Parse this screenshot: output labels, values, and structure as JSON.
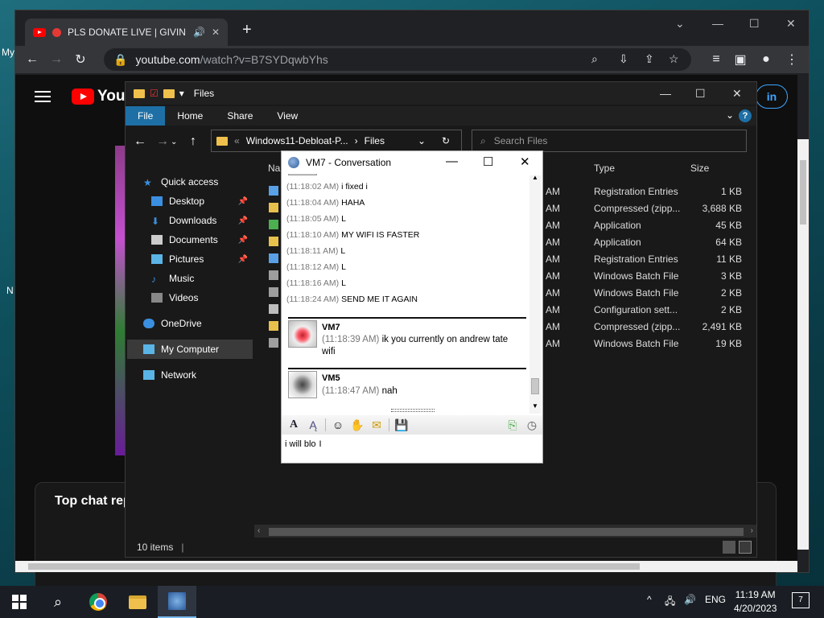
{
  "desktop": {
    "label_top": "My",
    "label_mid": "N"
  },
  "browser": {
    "tab_title": "PLS DONATE LIVE | GIVIN",
    "url_host": "youtube.com",
    "url_path": "/watch?v=B7SYDqwbYhs",
    "new_tab_label": "+",
    "minimize": "—",
    "maximize": "☐",
    "close": "✕"
  },
  "youtube": {
    "logo_text": "YouTu",
    "signin_label": "in",
    "chat_title": "Top chat rep"
  },
  "explorer": {
    "title": "Files",
    "ribbon_tabs": [
      "File",
      "Home",
      "Share",
      "View"
    ],
    "address_path_1": "Windows11-Debloat-P...",
    "address_sep": "›",
    "address_path_2": "Files",
    "search_placeholder": "Search Files",
    "nav": {
      "quick_access": "Quick access",
      "desktop": "Desktop",
      "downloads": "Downloads",
      "documents": "Documents",
      "pictures": "Pictures",
      "music": "Music",
      "videos": "Videos",
      "onedrive": "OneDrive",
      "mycomputer": "My Computer",
      "network": "Network"
    },
    "columns": {
      "name": "Na",
      "type": "Type",
      "size": "Size"
    },
    "files": [
      {
        "time": "AM",
        "type": "Registration Entries",
        "size": "1 KB",
        "color": "#5aa0e6"
      },
      {
        "time": "AM",
        "type": "Compressed (zipp...",
        "size": "3,688 KB",
        "color": "#e8c14c"
      },
      {
        "time": "AM",
        "type": "Application",
        "size": "45 KB",
        "color": "#4caf50"
      },
      {
        "time": "AM",
        "type": "Application",
        "size": "64 KB",
        "color": "#e8c14c"
      },
      {
        "time": "AM",
        "type": "Registration Entries",
        "size": "11 KB",
        "color": "#5aa0e6"
      },
      {
        "time": "AM",
        "type": "Windows Batch File",
        "size": "3 KB",
        "color": "#9e9e9e"
      },
      {
        "time": "AM",
        "type": "Windows Batch File",
        "size": "2 KB",
        "color": "#9e9e9e"
      },
      {
        "time": "AM",
        "type": "Configuration sett...",
        "size": "2 KB",
        "color": "#bdbdbd"
      },
      {
        "time": "AM",
        "type": "Compressed (zipp...",
        "size": "2,491 KB",
        "color": "#e8c14c"
      },
      {
        "time": "AM",
        "type": "Windows Batch File",
        "size": "19 KB",
        "color": "#9e9e9e"
      }
    ],
    "status": "10 items"
  },
  "conversation": {
    "title": "VM7 - Conversation",
    "history": [
      {
        "time": "(11:18:02 AM)",
        "text": "i fixed i"
      },
      {
        "time": "(11:18:04 AM)",
        "text": "HAHA"
      },
      {
        "time": "(11:18:05 AM)",
        "text": "L"
      },
      {
        "time": "(11:18:10 AM)",
        "text": "MY WIFI IS FASTER"
      },
      {
        "time": "(11:18:11 AM)",
        "text": "L"
      },
      {
        "time": "(11:18:12 AM)",
        "text": "L"
      },
      {
        "time": "(11:18:16 AM)",
        "text": "L"
      },
      {
        "time": "(11:18:24 AM)",
        "text": "SEND ME IT AGAIN"
      }
    ],
    "vm7": {
      "name": "VM7",
      "time": "(11:18:39 AM)",
      "text_1": "ik you currently on andrew tate",
      "text_2": "wifi"
    },
    "vm5": {
      "name": "VM5",
      "time": "(11:18:47 AM)",
      "text": "nah"
    },
    "input_value": "i will blo"
  },
  "taskbar": {
    "lang": "ENG",
    "time": "11:19 AM",
    "date": "4/20/2023",
    "notifications": "7"
  }
}
